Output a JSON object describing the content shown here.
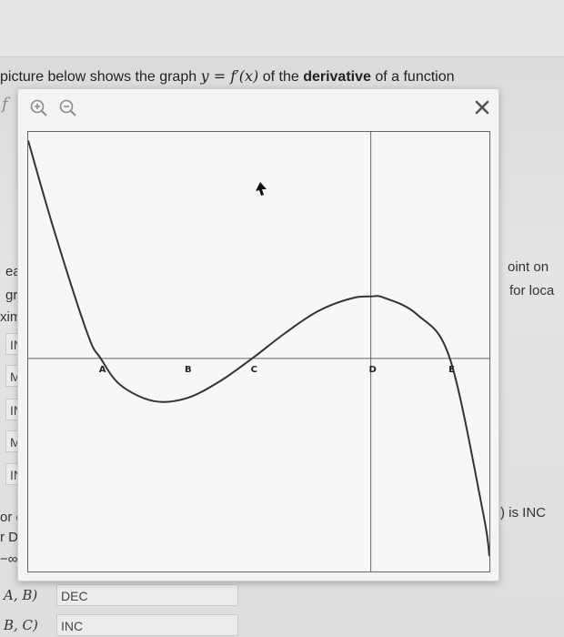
{
  "question": {
    "heading_prefix": "picture below shows the graph ",
    "heading_math": "y = f′(x)",
    "heading_mid": " of the ",
    "heading_bold": "derivative",
    "heading_suffix": " of a function",
    "function_letter": "f"
  },
  "background": {
    "left_fragments": [
      "ea",
      "gra",
      "xim"
    ],
    "answer_rows": [
      "IN",
      "M",
      "IN",
      "M",
      "IN"
    ],
    "right_fragments": [
      "oint on",
      "for loca"
    ],
    "right_inc": ") is INC",
    "bottom_fragments": [
      "or ea",
      "r DEC",
      "−∞,"
    ],
    "intervals": [
      {
        "label": "A, B)",
        "value": "DEC"
      },
      {
        "label": "B, C)",
        "value": "INC"
      }
    ]
  },
  "modal": {
    "zoom_in_icon": "zoom-in-icon",
    "zoom_out_icon": "zoom-out-icon",
    "close_icon": "close-icon"
  },
  "chart_data": {
    "type": "line",
    "title": "",
    "xlabel": "",
    "ylabel": "",
    "grid": false,
    "xlim": [
      -3.4,
      3.6
    ],
    "ylim": [
      -3.2,
      3.4
    ],
    "x_axis_at_y": 0,
    "y_axis_at_x": 1.8,
    "series": [
      {
        "name": "",
        "x": [
          -3.4,
          -3.0,
          -2.5,
          -2.3,
          -2.0,
          -1.5,
          -1.0,
          -0.5,
          0.0,
          0.5,
          1.0,
          1.5,
          1.8,
          2.0,
          2.5,
          3.0,
          3.5,
          3.6
        ],
        "y": [
          3.27,
          1.9,
          0.37,
          0.0,
          -0.4,
          -0.64,
          -0.6,
          -0.35,
          0.0,
          0.38,
          0.71,
          0.9,
          0.93,
          0.91,
          0.66,
          0.0,
          -2.3,
          -2.97
        ]
      }
    ],
    "points": [
      {
        "label": "A",
        "x": -2.3,
        "y": 0
      },
      {
        "label": "B",
        "x": -1.0,
        "y": 0
      },
      {
        "label": "C",
        "x": 0.0,
        "y": 0
      },
      {
        "label": "D",
        "x": 1.8,
        "y": 0
      },
      {
        "label": "E",
        "x": 3.0,
        "y": 0
      }
    ]
  }
}
